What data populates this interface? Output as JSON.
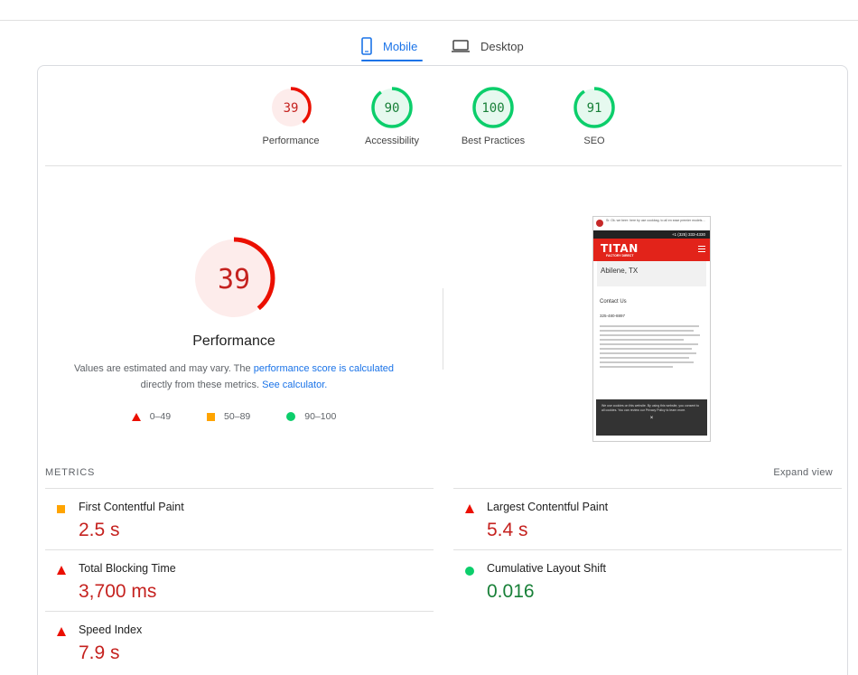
{
  "tabs": [
    {
      "label": "Mobile",
      "icon": "phone-icon",
      "active": true
    },
    {
      "label": "Desktop",
      "icon": "laptop-icon",
      "active": false
    }
  ],
  "categories": [
    {
      "label": "Performance",
      "score": "39",
      "value": 39,
      "rating": "fail"
    },
    {
      "label": "Accessibility",
      "score": "90",
      "value": 90,
      "rating": "pass"
    },
    {
      "label": "Best Practices",
      "score": "100",
      "value": 100,
      "rating": "pass"
    },
    {
      "label": "SEO",
      "score": "91",
      "value": 91,
      "rating": "pass"
    }
  ],
  "colors": {
    "fail": "#eb0f00",
    "fail_bg": "#fdeceb",
    "pass": "#0cce6b",
    "pass_bg": "#e6f9ef",
    "average": "#ffa400",
    "link": "#1a73e8"
  },
  "performance": {
    "score": "39",
    "value": 39,
    "title": "Performance",
    "desc_prefix": "Values are estimated and may vary. The ",
    "desc_link": "performance score is calculated",
    "desc_middle": "directly from these metrics. ",
    "desc_link2": "See calculator.",
    "legend": [
      {
        "range": "0–49",
        "shape": "triangle"
      },
      {
        "range": "50–89",
        "shape": "square"
      },
      {
        "range": "90–100",
        "shape": "circle"
      }
    ]
  },
  "screenshot": {
    "notice": "Sr. Ok. we beer: here by use cookbag. to all en ease premier models…",
    "phone": "+1 (325) 333-4330",
    "logo": "TITAN",
    "logo_sub": "FACTORY DIRECT",
    "city": "Abilene, TX",
    "contact": "Contact Us",
    "number": "325-480-8897",
    "cookie": "We use cookies on this website. By using this website, you consent to all cookies. You can review our Privacy Policy to learn more.",
    "close": "×"
  },
  "metrics": {
    "heading": "METRICS",
    "expand": "Expand view",
    "items": [
      {
        "label": "First Contentful Paint",
        "value": "2.5 s",
        "rating": "average"
      },
      {
        "label": "Largest Contentful Paint",
        "value": "5.4 s",
        "rating": "fail"
      },
      {
        "label": "Total Blocking Time",
        "value": "3,700 ms",
        "rating": "fail"
      },
      {
        "label": "Cumulative Layout Shift",
        "value": "0.016",
        "rating": "pass"
      },
      {
        "label": "Speed Index",
        "value": "7.9 s",
        "rating": "fail"
      }
    ]
  }
}
